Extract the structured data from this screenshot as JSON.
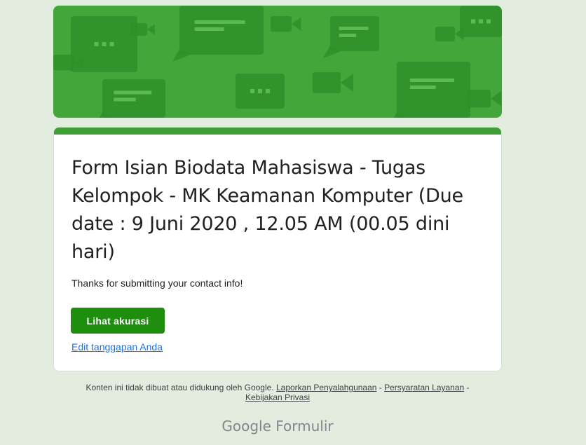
{
  "header": {
    "banner_color": "#43a63a",
    "pattern_color": "#2f8f2a",
    "pattern_icons": [
      "chat-bubble-icon",
      "video-camera-icon"
    ]
  },
  "form": {
    "accent_color": "#3f9e36",
    "title": "Form Isian Biodata Mahasiswa - Tugas Kelompok - MK Keamanan Komputer (Due date : 9 Juni 2020 , 12.05 AM (00.05 dini hari)",
    "confirmation_message": "Thanks for submitting your contact info!",
    "primary_button_label": "Lihat akurasi",
    "primary_button_color": "#1e8e0e",
    "edit_link_label": "Edit tanggapan Anda",
    "link_color": "#1a73e8"
  },
  "footer": {
    "disclaimer": "Konten ini tidak dibuat atau didukung oleh Google.",
    "report_abuse": "Laporkan Penyalahgunaan",
    "separator": " - ",
    "terms": "Persyaratan Layanan",
    "privacy": "Kebijakan Privasi"
  },
  "brand": {
    "google": "Google",
    "product": "Formulir"
  },
  "page_background": "#e3eddf"
}
